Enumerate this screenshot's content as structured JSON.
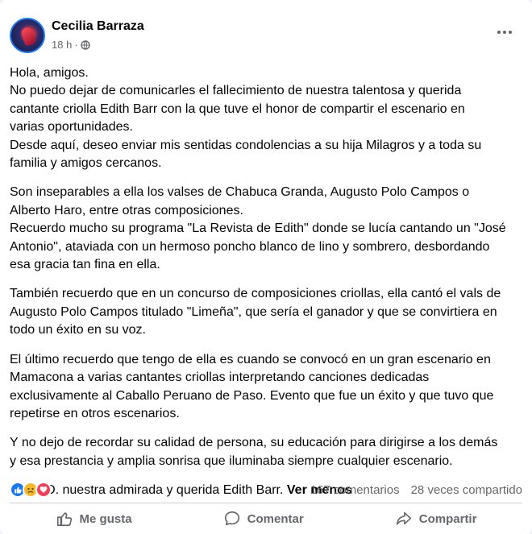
{
  "post": {
    "author": "Cecilia Barraza",
    "time": "18 h",
    "separator": "·",
    "paragraphs": [
      [
        "Hola, amigos.",
        "No puedo dejar de comunicarles el fallecimiento de nuestra talentosa y querida",
        "cantante criolla Edith Barr con la que tuve el honor de compartir el escenario en",
        "varias oportunidades.",
        "Desde aquí, deseo enviar mis sentidas condolencias a su hija Milagros y a toda su",
        "familia y amigos cercanos."
      ],
      [
        "Son inseparables a ella los valses de Chabuca Granda, Augusto Polo Campos o",
        "Alberto Haro, entre otras composiciones.",
        "Recuerdo mucho su programa \"La Revista de Edith\" donde se lucía cantando un \"José",
        "Antonio\", ataviada con un hermoso poncho blanco de lino y sombrero, desbordando",
        "esa gracia tan fina en ella."
      ],
      [
        "También recuerdo que en un concurso de composiciones criollas, ella cantó el vals de",
        "Augusto Polo Campos titulado \"Limeña\", que sería el ganador y que se convirtiera en",
        "todo un éxito en su voz."
      ],
      [
        "El último recuerdo que tengo de ella es cuando se convocó en un gran escenario en",
        "Mamacona a varias cantantes criollas interpretando canciones dedicadas",
        "exclusivamente al Caballo Peruano de Paso. Evento que fue un éxito y que tuvo que",
        "repetirse en otros escenarios."
      ],
      [
        "Y no dejo de recordar su calidad de persona, su educación para dirigirse a los demás",
        "y esa prestancia y amplia sonrisa que iluminaba siempre cualquier escenario."
      ]
    ],
    "last_line": "Q.E.P.D. nuestra admirada y querida Edith Barr.",
    "see_less": "Ver menos"
  },
  "stats": {
    "reactions": [
      "like",
      "sad",
      "love"
    ],
    "comments": "167 comentarios",
    "shares": "28 veces compartido"
  },
  "actions": {
    "like": "Me gusta",
    "comment": "Comentar",
    "share": "Compartir"
  },
  "colors": {
    "accent": "#1877f2",
    "muted_text": "#65676b",
    "love": "#f33e58",
    "sad": "#f7b928"
  },
  "icons": {
    "privacy": "globe-icon",
    "menu": "more-options-icon",
    "like": "thumbs-up-icon",
    "comment": "comment-bubble-icon",
    "share": "share-arrow-icon"
  }
}
